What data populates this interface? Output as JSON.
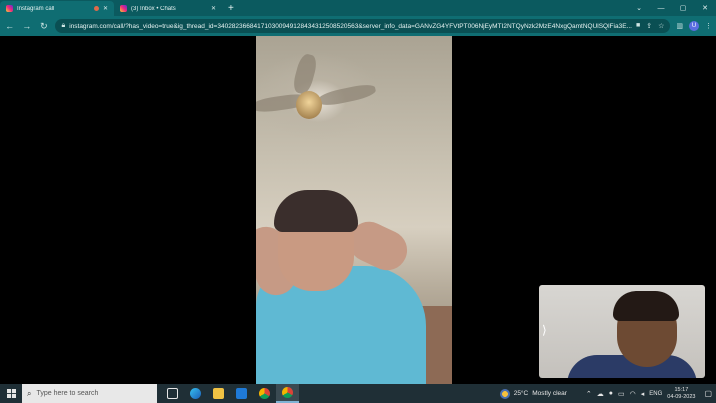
{
  "browser": {
    "tabs": [
      {
        "title": "Instagram call",
        "active": true,
        "favicon": "instagram-icon",
        "recording": true
      },
      {
        "title": "(3) Inbox • Chats",
        "active": false,
        "favicon": "instagram-icon"
      }
    ],
    "new_tab": "+",
    "url": "instagram.com/call/?has_video=true&ig_thread_id=340282366841710300949128434312508520563&server_info_data=GANvZG4YFVtPT006NjEyMTI2NTQyNzk2MzE4NxgQamtNQUlSQlFia3E...",
    "profile_initial": "U"
  },
  "taskbar": {
    "search_placeholder": "Type here to search",
    "weather": {
      "temp": "25°C",
      "condition": "Mostly clear"
    },
    "language": "ENG",
    "time": "15:17",
    "date": "04-09-2023"
  },
  "colors": {
    "browser_frame": "#0b5a5f",
    "taskbar": "#1f2f36"
  }
}
